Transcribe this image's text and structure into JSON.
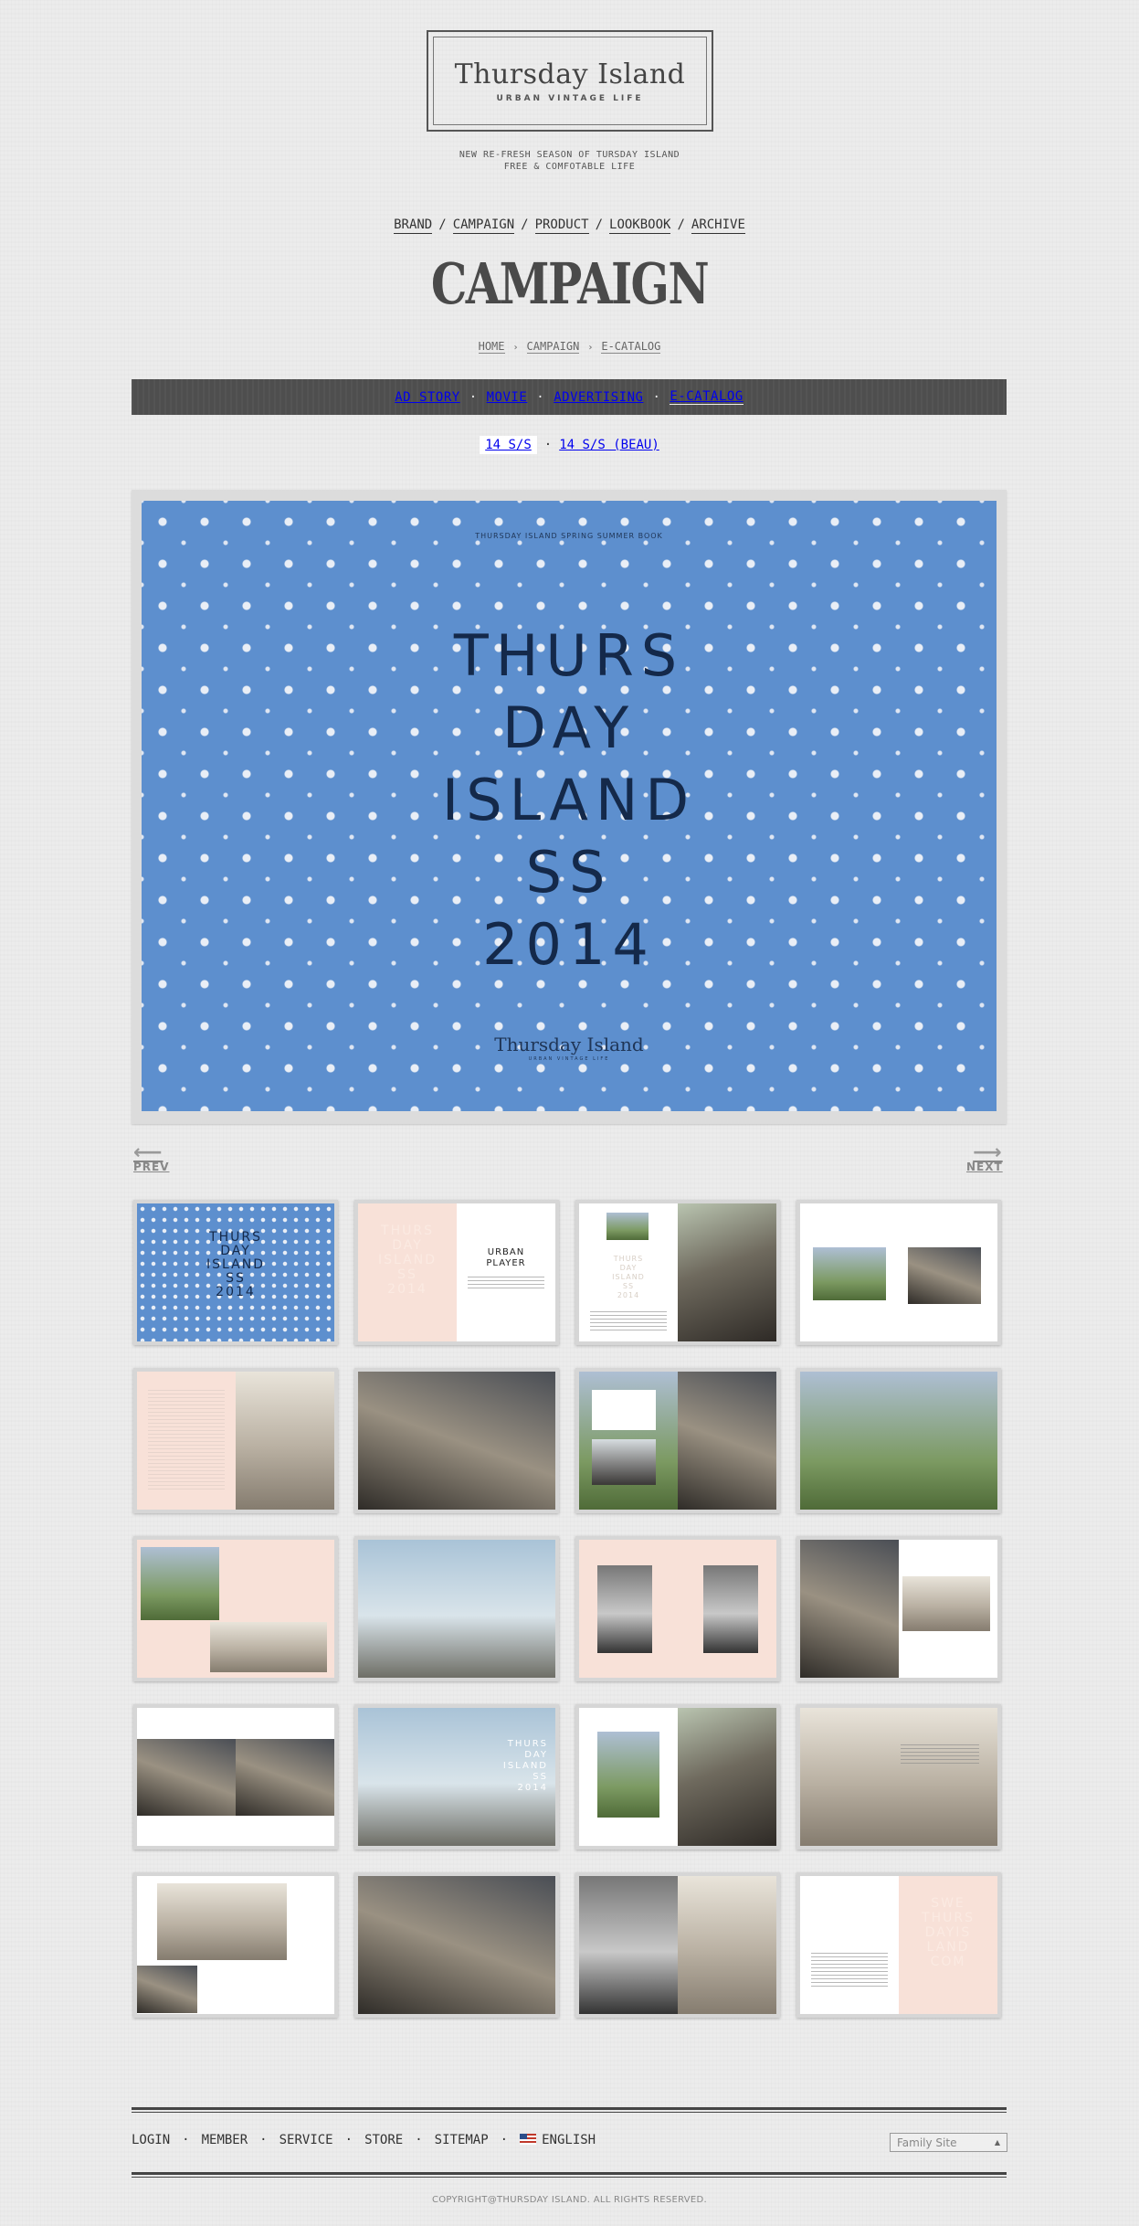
{
  "header": {
    "logo_title": "Thursday Island",
    "logo_sub": "URBAN VINTAGE LIFE",
    "tagline_1": "NEW RE-FRESH SEASON OF TURSDAY ISLAND",
    "tagline_2": "FREE & COMFOTABLE LIFE"
  },
  "nav": {
    "items": [
      "BRAND",
      "CAMPAIGN",
      "PRODUCT",
      "LOOKBOOK",
      "ARCHIVE"
    ],
    "separator": "/"
  },
  "page_title": "CAMPAIGN",
  "breadcrumb": {
    "items": [
      "HOME",
      "CAMPAIGN",
      "E-CATALOG"
    ],
    "arrow": "›"
  },
  "subnav": {
    "items": [
      "AD STORY",
      "MOVIE",
      "ADVERTISING",
      "E-CATALOG"
    ],
    "active": "E-CATALOG",
    "separator": "·"
  },
  "seasons": {
    "items": [
      "14 S/S",
      "14 S/S (BEAU)"
    ],
    "selected": "14 S/S"
  },
  "viewer": {
    "small_caption": "THURSDAY ISLAND SPRING SUMMER BOOK",
    "title": "THURS\nDAY\nISLAND\nSS\n2014",
    "brand": "Thursday Island",
    "brand_sub": "URBAN VINTAGE LIFE",
    "background_color": "#5d8fce",
    "title_color": "#14294a"
  },
  "pager": {
    "prev": "PREV",
    "next": "NEXT",
    "prev_arrow": "⟵",
    "next_arrow": "⟶"
  },
  "thumbnails": {
    "t1": "THURS\nDAY\nISLAND\nSS\n2014",
    "t2_left": "THURS\nDAY\nISLAND\nSS\n2014",
    "t2_right": "URBAN\nPLAYER",
    "t3_left": "THURS\nDAY\nISLAND\nSS\n2014",
    "t14_right": "THURS\nDAY\nISLAND\nSS\n2014",
    "t20_right": "SWE\nTHURS\nDAYIS\nLAND\nCOM"
  },
  "footer": {
    "links": [
      "LOGIN",
      "MEMBER",
      "SERVICE",
      "STORE",
      "SITEMAP"
    ],
    "language": "ENGLISH",
    "family_site": "Family Site",
    "copyright": "COPYRIGHT@THURSDAY ISLAND. ALL RIGHTS RESERVED."
  }
}
